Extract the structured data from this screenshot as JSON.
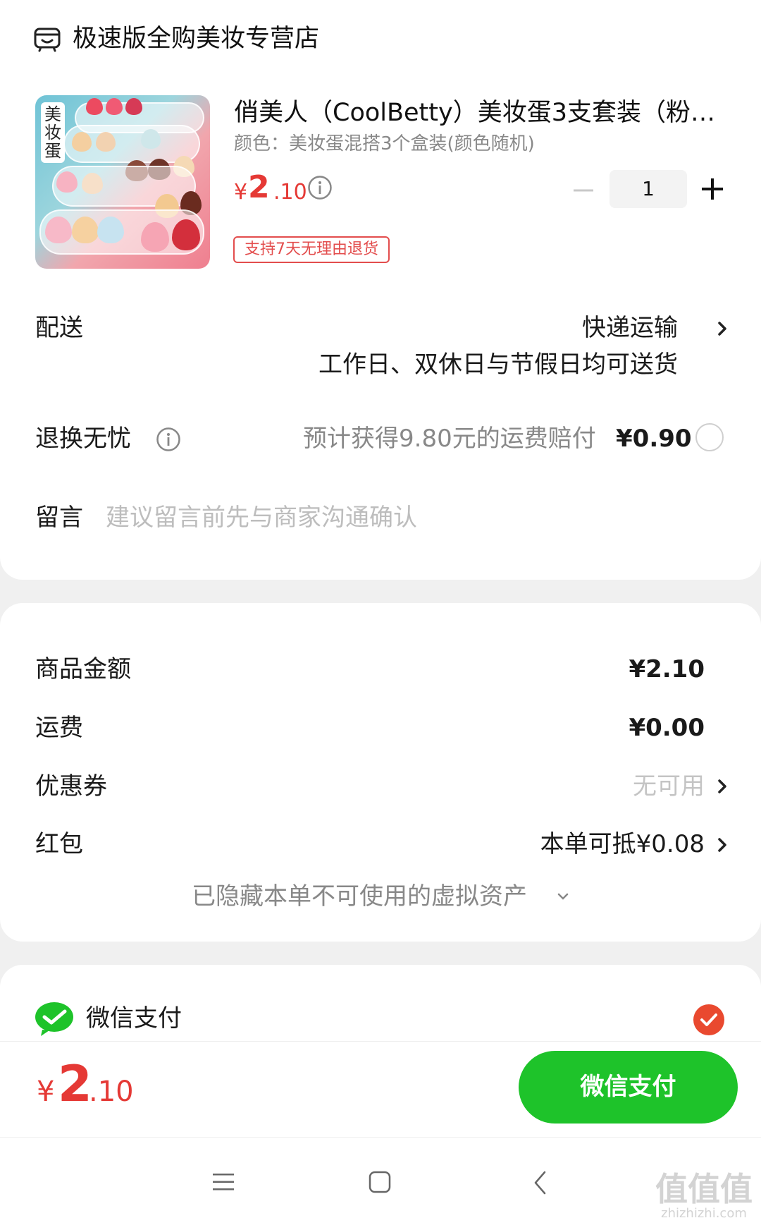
{
  "store": {
    "name": "极速版全购美妆专营店",
    "icon": "store-icon"
  },
  "product": {
    "thumb_tag": "美妆蛋",
    "title": "俏美人（CoolBetty）美妆蛋3支套装（粉…",
    "spec": "颜色：美妆蛋混搭3个盒装(颜色随机)",
    "price_symbol": "¥",
    "price_int": "2",
    "price_dec": ".10",
    "quantity": "1",
    "refund_badge": "支持7天无理由退货"
  },
  "delivery": {
    "label": "配送",
    "method": "快递运输",
    "note": "工作日、双休日与节假日均可送货"
  },
  "return_insurance": {
    "label": "退换无忧",
    "desc": "预计获得9.80元的运费赔付",
    "price": "¥0.90"
  },
  "message": {
    "label": "留言",
    "placeholder": "建议留言前先与商家沟通确认"
  },
  "summary": {
    "items": [
      {
        "label": "商品金额",
        "value": "¥2.10"
      },
      {
        "label": "运费",
        "value": "¥0.00"
      },
      {
        "label": "优惠券",
        "value": "无可用"
      },
      {
        "label": "红包",
        "value": "本单可抵¥0.08"
      }
    ],
    "hidden_note": "已隐藏本单不可使用的虚拟资产"
  },
  "payment": {
    "method": "微信支付",
    "selected": true
  },
  "footer": {
    "total_symbol": "¥",
    "total_int": "2",
    "total_dec": ".10",
    "pay_button": "微信支付"
  },
  "watermark": {
    "main": "值值值",
    "sub": "zhizhizhi.com"
  },
  "colors": {
    "price_red": "#e53935",
    "wechat_green": "#1ec32a",
    "check_red": "#e9492f"
  }
}
